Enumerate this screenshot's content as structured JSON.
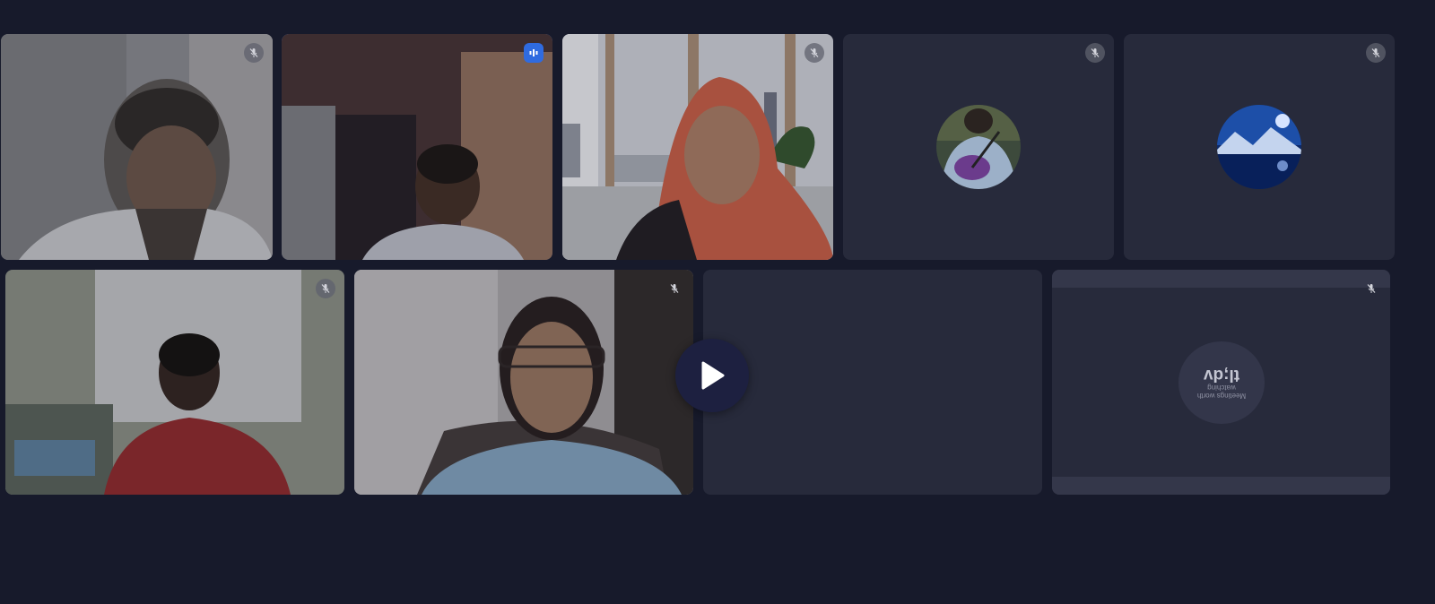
{
  "participants": [
    {
      "id": "p1",
      "state": "muted"
    },
    {
      "id": "p2",
      "state": "speaking"
    },
    {
      "id": "p3",
      "state": "muted"
    },
    {
      "id": "p4",
      "state": "muted",
      "avatar": "photo"
    },
    {
      "id": "p5",
      "state": "muted",
      "avatar": "night-moon"
    },
    {
      "id": "p6",
      "state": "muted"
    },
    {
      "id": "p7",
      "state": "muted"
    },
    {
      "id": "p8",
      "state": "empty"
    },
    {
      "id": "p9",
      "state": "muted"
    }
  ],
  "badge": {
    "title": "tl;dv",
    "subtitle": "Meetings worth watching"
  },
  "colors": {
    "background": "#171a2b",
    "tile": "#272a3b",
    "active_outline": "#4b7fd6",
    "speaking": "#2f6be0"
  },
  "icons": {
    "muted": "mic-off-icon",
    "speaking": "audio-bars-icon",
    "play": "play-icon"
  }
}
